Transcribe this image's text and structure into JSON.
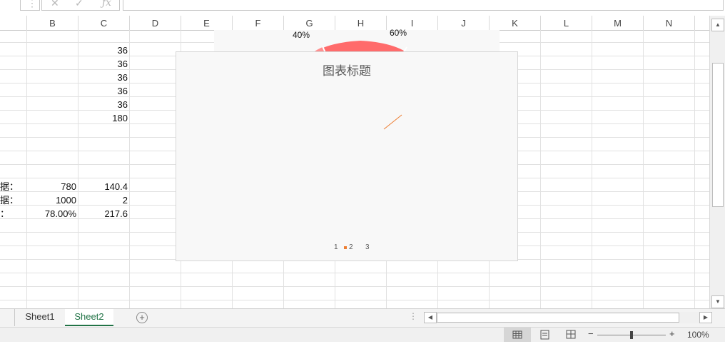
{
  "columns": [
    "B",
    "C",
    "D",
    "E",
    "F",
    "G",
    "H",
    "I",
    "J",
    "K",
    "L",
    "M",
    "N"
  ],
  "cells": {
    "c_values": [
      "36",
      "36",
      "36",
      "36",
      "36",
      "180"
    ],
    "row_labels": [
      "据：",
      "据：",
      "："
    ],
    "b_values": [
      "780",
      "1000",
      "78.00%"
    ],
    "c_values2": [
      "140.4",
      "2",
      "217.6"
    ]
  },
  "pie_labels": [
    "40%",
    "60%"
  ],
  "chart": {
    "title": "图表标题",
    "legend": [
      "1",
      "2",
      "3"
    ]
  },
  "tabs": [
    "Sheet1",
    "Sheet2"
  ],
  "status": {
    "zoom": "100%"
  },
  "colors": {
    "accent": "#217346",
    "pie": "#ff6b6b",
    "series2": "#ed7d31"
  }
}
